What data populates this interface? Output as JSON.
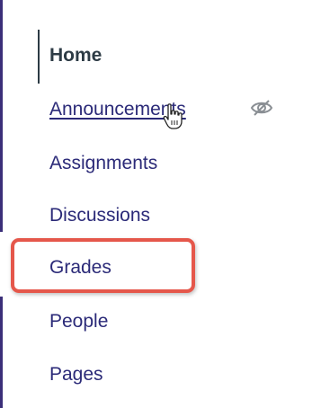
{
  "nav": {
    "items": [
      {
        "label": "Home",
        "state": "active"
      },
      {
        "label": "Announcements",
        "state": "hovered",
        "visibility": "hidden-from-students"
      },
      {
        "label": "Assignments"
      },
      {
        "label": "Discussions"
      },
      {
        "label": "Grades",
        "highlighted": true
      },
      {
        "label": "People"
      },
      {
        "label": "Pages"
      }
    ]
  },
  "icons": {
    "visibility": "eye-slash-icon",
    "cursor": "hand-pointer-icon"
  },
  "colors": {
    "link": "#2b2a78",
    "active_text": "#2d3b45",
    "highlight_border": "#e5574b"
  }
}
